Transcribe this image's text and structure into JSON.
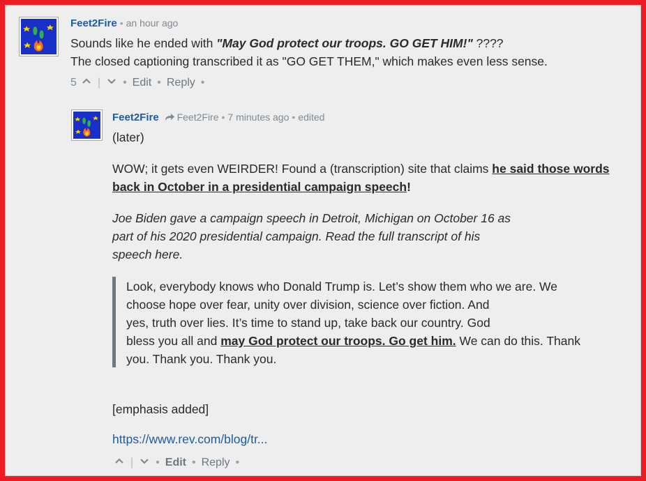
{
  "comment1": {
    "author": "Feet2Fire",
    "time": "an hour ago",
    "line1_prefix": "Sounds like he ended with ",
    "line1_quote": "\"May God protect our troops. GO GET HIM!\"",
    "line1_suffix": " ????",
    "line2": "The closed captioning transcribed it as \"GO GET THEM,\" which makes even less sense.",
    "votes": "5",
    "edit_label": "Edit",
    "reply_label": "Reply"
  },
  "comment2": {
    "author": "Feet2Fire",
    "reply_to": "Feet2Fire",
    "time": "7 minutes ago",
    "edited": "edited",
    "later": "(later)",
    "p1_prefix": "WOW; it gets even WEIRDER! Found a (transcription) site that claims ",
    "p1_link": "he said those words back in October in a presidential campaign speech",
    "p1_suffix": "!",
    "p2_line1": "Joe Biden gave a campaign speech in Detroit, Michigan on October 16 as",
    "p2_line2": "part of his 2020 presidential campaign. Read the full transcript of his",
    "p2_line3": "speech here.",
    "q_line1": "Look, everybody knows who Donald Trump is. Let’s show them who we are. We",
    "q_line2": "choose hope over fear, unity over division, science over fiction. And",
    "q_line3": "yes, truth over lies. It’s time to stand up, take back our country. God",
    "q_line4_prefix": "bless you all and ",
    "q_line4_emph": "may God protect our troops. Go get him.",
    "q_line4_suffix": " We can do this. Thank",
    "q_line5": "you. Thank you. Thank you.",
    "emphasis": "[emphasis added]",
    "url": "https://www.rev.com/blog/tr...",
    "edit_label": "Edit",
    "reply_label": "Reply"
  },
  "colors": {
    "frame_border": "#ed1c24",
    "link": "#1a5da6",
    "background": "#eeeeee"
  },
  "icons": {
    "avatar": "feet-fire-avatar",
    "upvote": "chevron-up-icon",
    "downvote": "chevron-down-icon",
    "reply_arrow": "reply-arrow-icon"
  }
}
